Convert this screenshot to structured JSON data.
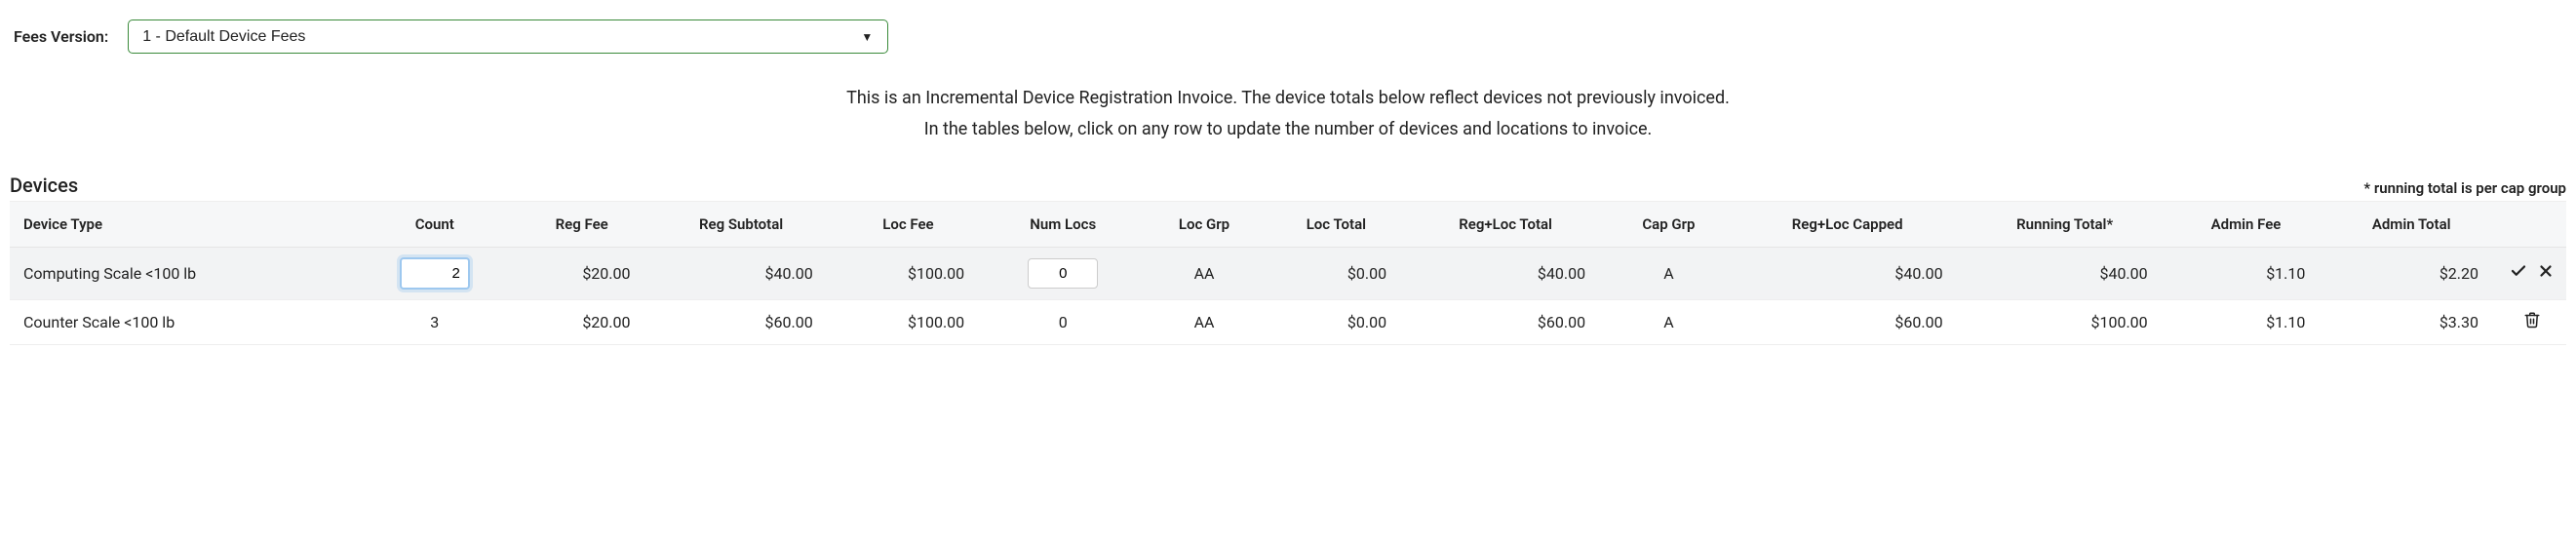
{
  "header": {
    "fees_version_label": "Fees Version:",
    "fees_version_value": "1 - Default Device Fees"
  },
  "info": {
    "line1": "This is an Incremental Device Registration Invoice. The device totals below reflect devices not previously invoiced.",
    "line2": "In the tables below, click on any row to update the number of devices and locations to invoice."
  },
  "section": {
    "title": "Devices",
    "note": "* running total is per cap group"
  },
  "columns": {
    "device_type": "Device Type",
    "count": "Count",
    "reg_fee": "Reg Fee",
    "reg_subtotal": "Reg Subtotal",
    "loc_fee": "Loc Fee",
    "num_locs": "Num Locs",
    "loc_grp": "Loc Grp",
    "loc_total": "Loc Total",
    "regloc_total": "Reg+Loc Total",
    "cap_grp": "Cap Grp",
    "regloc_capped": "Reg+Loc Capped",
    "running_total": "Running Total*",
    "admin_fee": "Admin Fee",
    "admin_total": "Admin Total"
  },
  "rows": [
    {
      "device_type": "Computing Scale <100 lb",
      "count": "2",
      "count_editable": true,
      "reg_fee": "$20.00",
      "reg_subtotal": "$40.00",
      "loc_fee": "$100.00",
      "num_locs": "0",
      "numlocs_editable": true,
      "loc_grp": "AA",
      "loc_total": "$0.00",
      "regloc_total": "$40.00",
      "cap_grp": "A",
      "regloc_capped": "$40.00",
      "running_total": "$40.00",
      "admin_fee": "$1.10",
      "admin_total": "$2.20",
      "actions": "confirm-cancel"
    },
    {
      "device_type": "Counter Scale <100 lb",
      "count": "3",
      "count_editable": false,
      "reg_fee": "$20.00",
      "reg_subtotal": "$60.00",
      "loc_fee": "$100.00",
      "num_locs": "0",
      "numlocs_editable": false,
      "loc_grp": "AA",
      "loc_total": "$0.00",
      "regloc_total": "$60.00",
      "cap_grp": "A",
      "regloc_capped": "$60.00",
      "running_total": "$100.00",
      "admin_fee": "$1.10",
      "admin_total": "$3.30",
      "actions": "delete"
    }
  ]
}
